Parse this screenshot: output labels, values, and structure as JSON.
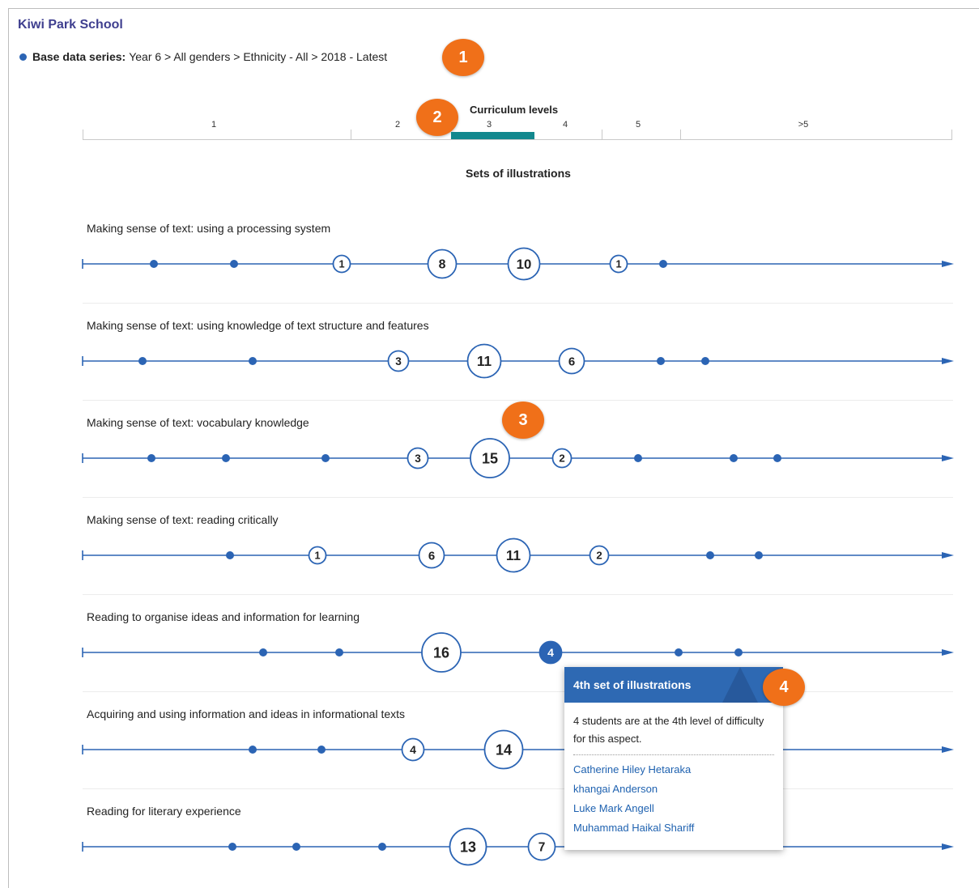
{
  "school_name": "Kiwi Park School",
  "base_series": {
    "label": "Base data series:",
    "value": "Year 6 > All genders > Ethnicity - All > 2018 - Latest"
  },
  "callouts": [
    "1",
    "2",
    "3",
    "4"
  ],
  "scale": {
    "title": "Curriculum levels",
    "levels": [
      "1",
      "2",
      "3",
      "4",
      "5",
      ">5"
    ]
  },
  "sets_title": "Sets of illustrations",
  "colors": {
    "line": "#2b64b4",
    "accent": "#f07019",
    "highlight": "#12888e"
  },
  "aspects": [
    {
      "label": "Making sense of text: using a processing system",
      "points": [
        {
          "pos": 1
        },
        {
          "pos": 2
        },
        {
          "pos": 3,
          "count": "1"
        },
        {
          "pos": 4,
          "count": "8"
        },
        {
          "pos": 5,
          "count": "10"
        },
        {
          "pos": 6,
          "count": "1"
        },
        {
          "pos": 7
        }
      ]
    },
    {
      "label": "Making sense of text: using knowledge of text structure and features",
      "points": [
        {
          "pos": 1
        },
        {
          "pos": 2
        },
        {
          "pos": 3,
          "count": "3"
        },
        {
          "pos": 4,
          "count": "11"
        },
        {
          "pos": 5,
          "count": "6"
        },
        {
          "pos": 6
        },
        {
          "pos": 7
        }
      ]
    },
    {
      "label": "Making sense of text: vocabulary knowledge",
      "points": [
        {
          "pos": 1
        },
        {
          "pos": 2
        },
        {
          "pos": 3
        },
        {
          "pos": 4,
          "count": "3"
        },
        {
          "pos": 5,
          "count": "15"
        },
        {
          "pos": 6,
          "count": "2"
        },
        {
          "pos": 7
        },
        {
          "pos": 8
        },
        {
          "pos": 9
        }
      ]
    },
    {
      "label": "Making sense of text: reading critically",
      "points": [
        {
          "pos": 1
        },
        {
          "pos": 2,
          "count": "1"
        },
        {
          "pos": 3,
          "count": "6"
        },
        {
          "pos": 4,
          "count": "11"
        },
        {
          "pos": 5,
          "count": "2"
        },
        {
          "pos": 6
        },
        {
          "pos": 7
        }
      ]
    },
    {
      "label": "Reading to organise ideas and information for learning",
      "points": [
        {
          "pos": 1
        },
        {
          "pos": 2
        },
        {
          "pos": 3,
          "count": "16"
        },
        {
          "pos": 4,
          "count": "4",
          "selected": true
        },
        {
          "pos": 5
        },
        {
          "pos": 6
        }
      ]
    },
    {
      "label": "Acquiring and using information and ideas in informational texts",
      "points": [
        {
          "pos": 1
        },
        {
          "pos": 2
        },
        {
          "pos": 3,
          "count": "4"
        },
        {
          "pos": 4,
          "count": "14"
        }
      ]
    },
    {
      "label": "Reading for literary experience",
      "points": [
        {
          "pos": 1
        },
        {
          "pos": 2
        },
        {
          "pos": 3
        },
        {
          "pos": 4,
          "count": "13"
        },
        {
          "pos": 5,
          "count": "7"
        }
      ]
    }
  ],
  "popup": {
    "title": "4th set of illustrations",
    "description": "4 students are at the 4th level of difficulty for this aspect.",
    "students": [
      "Catherine Hiley Hetaraka",
      "khangai Anderson",
      "Luke Mark Angell",
      "Muhammad Haikal Shariff"
    ]
  }
}
